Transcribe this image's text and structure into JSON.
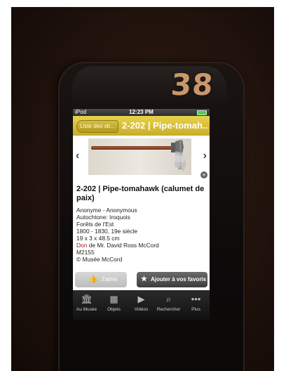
{
  "sticker_number": "38",
  "status_bar": {
    "carrier": "iPod",
    "time": "12:23 PM"
  },
  "nav": {
    "back_label": "Liste des ob...",
    "title": "2-202 | Pipe-tomah..."
  },
  "artwork": {
    "title": "2-202 | Pipe-tomahawk (calumet de paix)",
    "details": {
      "maker": "Anonyme - Anonymous",
      "culture": "Autochtone: Iroquois",
      "region": "Forêts de l'Est",
      "date": "1800 - 1830, 19e siècle",
      "dimensions": "19 x 3 x 48.5 cm",
      "donation_prefix": "Don",
      "donation_rest": " de Mr. David Ross McCord",
      "accession": "M2155",
      "copyright": "© Musée McCord"
    }
  },
  "actions": {
    "like_label": "J'aime",
    "favorite_label": "Ajouter à vos favoris"
  },
  "tabs": [
    {
      "label": "Au Musée",
      "icon": "museum-icon"
    },
    {
      "label": "Objets",
      "icon": "objects-icon"
    },
    {
      "label": "Vidéos",
      "icon": "video-icon"
    },
    {
      "label": "Rechercher",
      "icon": "search-icon"
    },
    {
      "label": "Plus",
      "icon": "more-icon"
    }
  ],
  "colors": {
    "nav_accent": "#d4bc34",
    "background": "#1a0f0a"
  }
}
